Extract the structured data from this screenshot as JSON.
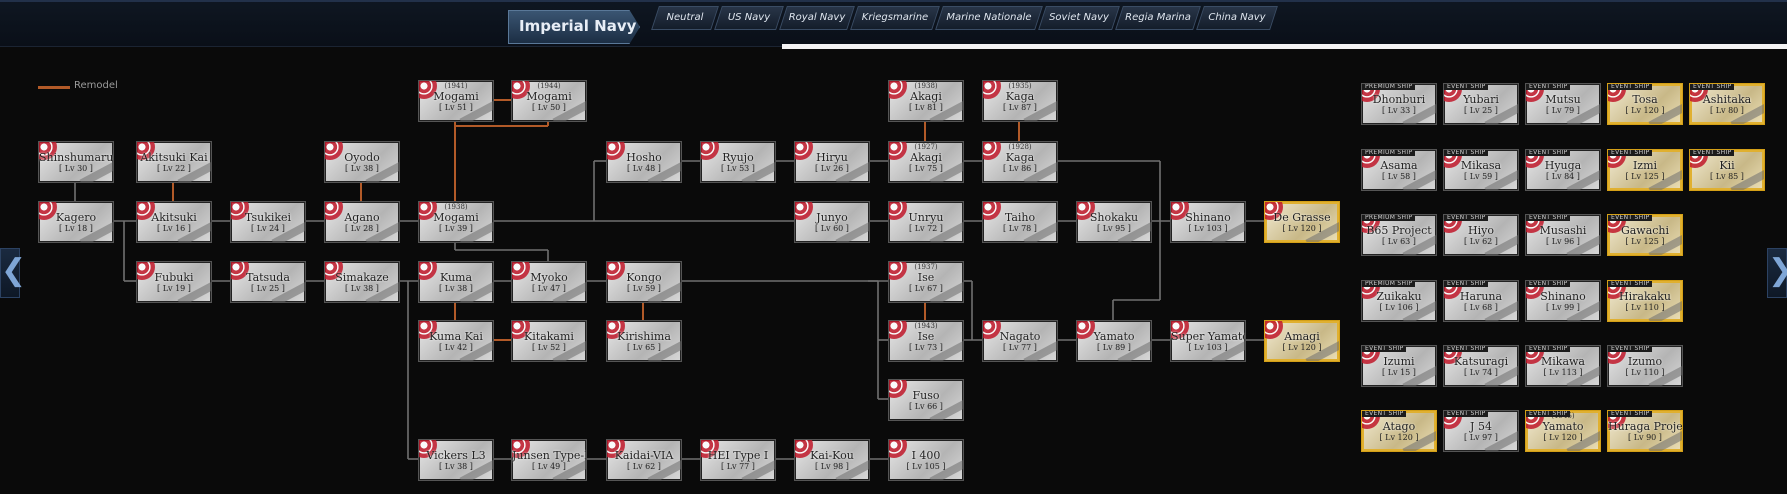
{
  "header": {
    "title": "Imperial Navy",
    "tabs": [
      "Neutral",
      "US Navy",
      "Royal Navy",
      "Kriegsmarine",
      "Marine Nationale",
      "Soviet Navy",
      "Regia Marina",
      "China Navy"
    ]
  },
  "legend": {
    "label": "Remodel",
    "color": "#b25a28"
  },
  "nav": {
    "left": "❮",
    "right": "❯"
  },
  "colors": {
    "line": "#707070",
    "remodel": "#b25a28",
    "gold_border": "#d4a017"
  },
  "ships": [
    {
      "id": "mogami1941",
      "name": "Mogami",
      "year": "(1941)",
      "level": "[ Lv 51 ]"
    },
    {
      "id": "mogami1944",
      "name": "Mogami",
      "year": "(1944)",
      "level": "[ Lv 50 ]"
    },
    {
      "id": "akagi1938",
      "name": "Akagi",
      "year": "(1938)",
      "level": "[ Lv 81 ]"
    },
    {
      "id": "kaga1935",
      "name": "Kaga",
      "year": "(1935)",
      "level": "[ Lv 87 ]"
    },
    {
      "id": "shinshumaru",
      "name": "Shinshumaru",
      "level": "[ Lv 30 ]"
    },
    {
      "id": "akitsukikai",
      "name": "Akitsuki Kai",
      "level": "[ Lv 22 ]"
    },
    {
      "id": "oyodo",
      "name": "Oyodo",
      "level": "[ Lv 38 ]"
    },
    {
      "id": "hosho",
      "name": "Hosho",
      "level": "[ Lv 48 ]"
    },
    {
      "id": "ryujo",
      "name": "Ryujo",
      "level": "[ Lv 53 ]"
    },
    {
      "id": "hiryu",
      "name": "Hiryu",
      "level": "[ Lv 26 ]"
    },
    {
      "id": "akagi1927",
      "name": "Akagi",
      "year": "(1927)",
      "level": "[ Lv 75 ]"
    },
    {
      "id": "kaga1928",
      "name": "Kaga",
      "year": "(1928)",
      "level": "[ Lv 86 ]"
    },
    {
      "id": "kagero",
      "name": "Kagero",
      "level": "[ Lv 18 ]"
    },
    {
      "id": "akitsuki",
      "name": "Akitsuki",
      "level": "[ Lv 16 ]"
    },
    {
      "id": "tsukikei",
      "name": "Tsukikei",
      "level": "[ Lv 24 ]"
    },
    {
      "id": "agano",
      "name": "Agano",
      "level": "[ Lv 28 ]"
    },
    {
      "id": "mogami1938",
      "name": "Mogami",
      "year": "(1938)",
      "level": "[ Lv 39 ]"
    },
    {
      "id": "junyo",
      "name": "Junyo",
      "level": "[ Lv 60 ]"
    },
    {
      "id": "unryu",
      "name": "Unryu",
      "level": "[ Lv 72 ]"
    },
    {
      "id": "taiho",
      "name": "Taiho",
      "level": "[ Lv 78 ]"
    },
    {
      "id": "shokaku",
      "name": "Shokaku",
      "level": "[ Lv 95 ]"
    },
    {
      "id": "shinano",
      "name": "Shinano",
      "level": "[ Lv 103 ]"
    },
    {
      "id": "degrasse",
      "name": "De Grasse",
      "level": "[ Lv 120 ]",
      "gold": true
    },
    {
      "id": "fubuki",
      "name": "Fubuki",
      "level": "[ Lv 19 ]"
    },
    {
      "id": "tatsuda",
      "name": "Tatsuda",
      "level": "[ Lv 25 ]"
    },
    {
      "id": "simakaze",
      "name": "Simakaze",
      "level": "[ Lv 38 ]"
    },
    {
      "id": "kuma",
      "name": "Kuma",
      "level": "[ Lv 38 ]"
    },
    {
      "id": "myoko",
      "name": "Myoko",
      "level": "[ Lv 47 ]"
    },
    {
      "id": "kongo",
      "name": "Kongo",
      "level": "[ Lv 59 ]"
    },
    {
      "id": "ise1937",
      "name": "Ise",
      "year": "(1937)",
      "level": "[ Lv 67 ]"
    },
    {
      "id": "kumakai",
      "name": "Kuma Kai",
      "level": "[ Lv 42 ]"
    },
    {
      "id": "kitakami",
      "name": "Kitakami",
      "level": "[ Lv 52 ]"
    },
    {
      "id": "kirishima",
      "name": "Kirishima",
      "level": "[ Lv 65 ]"
    },
    {
      "id": "ise1943",
      "name": "Ise",
      "year": "(1943)",
      "level": "[ Lv 73 ]"
    },
    {
      "id": "nagato",
      "name": "Nagato",
      "level": "[ Lv 77 ]"
    },
    {
      "id": "yamato",
      "name": "Yamato",
      "level": "[ Lv 89 ]"
    },
    {
      "id": "superyamato",
      "name": "Super Yamato",
      "level": "[ Lv 103 ]"
    },
    {
      "id": "amagi",
      "name": "Amagi",
      "level": "[ Lv 120 ]",
      "gold": true
    },
    {
      "id": "fuso",
      "name": "Fuso",
      "level": "[ Lv 66 ]"
    },
    {
      "id": "vickersl3",
      "name": "Vickers L3",
      "level": "[ Lv 38 ]"
    },
    {
      "id": "junsentype1",
      "name": "Junsen Type-I",
      "level": "[ Lv 49 ]"
    },
    {
      "id": "kaidaivija",
      "name": "Kaidai-VIA",
      "level": "[ Lv 62 ]"
    },
    {
      "id": "heitype1",
      "name": "HEI Type I",
      "level": "[ Lv 77 ]"
    },
    {
      "id": "kaikou",
      "name": "Kai-Kou",
      "level": "[ Lv 98 ]"
    },
    {
      "id": "i400",
      "name": "I 400",
      "level": "[ Lv 105 ]"
    },
    {
      "id": "dhonburi",
      "name": "Dhonburi",
      "level": "[ Lv 33 ]",
      "badge": "PREMIUM SHIP"
    },
    {
      "id": "yubari",
      "name": "Yubari",
      "level": "[ Lv 25 ]",
      "badge": "EVENT SHIP"
    },
    {
      "id": "mutsu",
      "name": "Mutsu",
      "level": "[ Lv 79 ]",
      "badge": "EVENT SHIP"
    },
    {
      "id": "tosa",
      "name": "Tosa",
      "level": "[ Lv 120 ]",
      "badge": "EVENT SHIP",
      "gold": true
    },
    {
      "id": "ashitaka",
      "name": "Ashitaka",
      "level": "[ Lv 80 ]",
      "badge": "EVENT SHIP",
      "gold": true
    },
    {
      "id": "asama",
      "name": "Asama",
      "level": "[ Lv 58 ]",
      "badge": "PREMIUM SHIP"
    },
    {
      "id": "mikasa",
      "name": "Mikasa",
      "level": "[ Lv 59 ]",
      "badge": "EVENT SHIP"
    },
    {
      "id": "hyuga",
      "name": "Hyuga",
      "level": "[ Lv 84 ]",
      "badge": "EVENT SHIP"
    },
    {
      "id": "izmi",
      "name": "Izmi",
      "level": "[ Lv 125 ]",
      "badge": "EVENT SHIP",
      "gold": true
    },
    {
      "id": "kii",
      "name": "Kii",
      "level": "[ Lv 85 ]",
      "badge": "EVENT SHIP",
      "gold": true
    },
    {
      "id": "b65project",
      "name": "B65 Project",
      "level": "[ Lv 63 ]",
      "badge": "PREMIUM SHIP"
    },
    {
      "id": "hiyo",
      "name": "Hiyo",
      "level": "[ Lv 62 ]",
      "badge": "EVENT SHIP"
    },
    {
      "id": "musashi",
      "name": "Musashi",
      "level": "[ Lv 96 ]",
      "badge": "EVENT SHIP"
    },
    {
      "id": "gawachi",
      "name": "Gawachi",
      "level": "[ Lv 125 ]",
      "badge": "EVENT SHIP",
      "gold": true
    },
    {
      "id": "zuikaku",
      "name": "Zuikaku",
      "level": "[ Lv 106 ]",
      "badge": "PREMIUM SHIP"
    },
    {
      "id": "haruna",
      "name": "Haruna",
      "level": "[ Lv 68 ]",
      "badge": "EVENT SHIP"
    },
    {
      "id": "shinano2",
      "name": "Shinano",
      "level": "[ Lv 99 ]",
      "badge": "EVENT SHIP"
    },
    {
      "id": "hirakaku",
      "name": "Hirakaku",
      "level": "[ Lv 110 ]",
      "badge": "EVENT SHIP",
      "gold": true
    },
    {
      "id": "izumi",
      "name": "Izumi",
      "level": "[ Lv 15 ]",
      "badge": "EVENT SHIP"
    },
    {
      "id": "katsuragi",
      "name": "Katsuragi",
      "level": "[ Lv 74 ]",
      "badge": "EVENT SHIP"
    },
    {
      "id": "mikawa",
      "name": "Mikawa",
      "level": "[ Lv 113 ]",
      "badge": "EVENT SHIP"
    },
    {
      "id": "izumo",
      "name": "Izumo",
      "level": "[ Lv 110 ]",
      "badge": "EVENT SHIP"
    },
    {
      "id": "atago",
      "name": "Atago",
      "level": "[ Lv 120 ]",
      "badge": "EVENT SHIP",
      "gold": true
    },
    {
      "id": "j54",
      "name": "J 54",
      "level": "[ Lv 97 ]",
      "badge": "EVENT SHIP"
    },
    {
      "id": "yamato1945",
      "name": "Yamato",
      "year": "(1945)",
      "level": "[ Lv 120 ]",
      "badge": "EVENT SHIP",
      "gold": true
    },
    {
      "id": "huragaproject",
      "name": "Huraga Project",
      "level": "[ Lv 90 ]",
      "badge": "EVENT SHIP",
      "gold": true
    }
  ]
}
